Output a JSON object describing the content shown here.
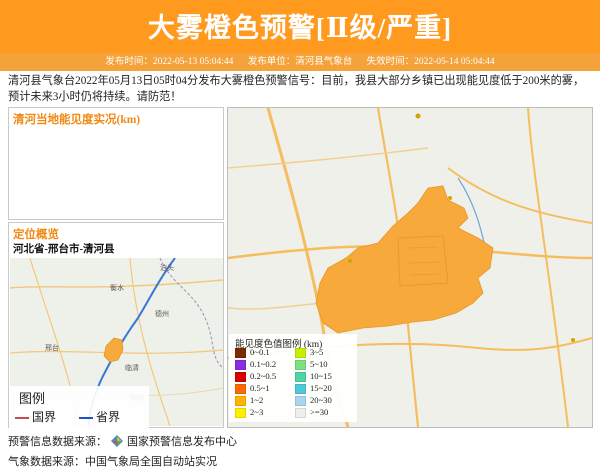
{
  "header": {
    "title": "大雾橙色预警[Ⅱ级/严重]",
    "publish_time": "发布时间：2022-05-13 05:04:44",
    "publisher": "发布单位：清河县气象台",
    "expire_time": "失效时间：2022-05-14 05:04:44"
  },
  "description": "清河县气象台2022年05月13日05时04分发布大雾橙色预警信号：目前，我县大部分乡镇已出现能见度低于200米的雾，预计未来3小时仍将持续。请防范！",
  "visibility_panel": {
    "title": "清河当地能见度实况(km)"
  },
  "location_panel": {
    "title": "定位概览",
    "subtitle": "河北省-邢台市-清河县"
  },
  "overview_map": {
    "places": [
      "泊头",
      "衡水",
      "德州",
      "邢台",
      "临清",
      "聊城"
    ]
  },
  "map_legend": {
    "title": "图例",
    "items": [
      {
        "label": "国界",
        "color": "#c0504d"
      },
      {
        "label": "省界",
        "color": "#1f4fd0"
      }
    ]
  },
  "visibility_legend": {
    "title": "能见度色值图例 (km)",
    "items": [
      {
        "label": "0~0.1",
        "color": "#7b2b00"
      },
      {
        "label": "0.1~0.2",
        "color": "#8a2be2"
      },
      {
        "label": "0.2~0.5",
        "color": "#d90000"
      },
      {
        "label": "0.5~1",
        "color": "#ff6a00"
      },
      {
        "label": "1~2",
        "color": "#ffb400"
      },
      {
        "label": "2~3",
        "color": "#ffee00"
      },
      {
        "label": "3~5",
        "color": "#c7f000"
      },
      {
        "label": "5~10",
        "color": "#7ee07e"
      },
      {
        "label": "10~15",
        "color": "#4fd4a4"
      },
      {
        "label": "15~20",
        "color": "#4ec9d8"
      },
      {
        "label": "20~30",
        "color": "#a9d6ee"
      },
      {
        "label": ">=30",
        "color": "#eeeeee"
      }
    ]
  },
  "sources": {
    "warning": "预警信息数据来源：",
    "warning_org": "国家预警信息发布中心",
    "weather": "气象数据来源：中国气象局全国自动站实况"
  },
  "colors": {
    "accent": "#ff9a1f",
    "fog_area": "#f7a93b"
  }
}
